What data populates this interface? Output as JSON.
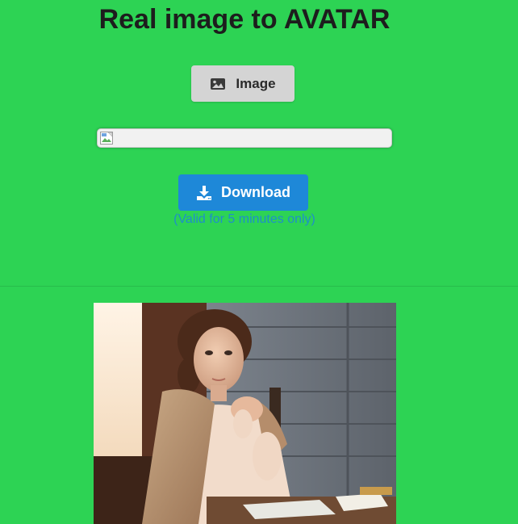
{
  "header": {
    "title": "Real image to AVATAR"
  },
  "upload": {
    "button_label": "Image",
    "icon": "image-icon"
  },
  "result_image": {
    "state": "broken",
    "icon": "broken-image-icon"
  },
  "download": {
    "button_label": "Download",
    "icon": "download-icon",
    "note": "(Valid for 5 minutes only)"
  },
  "colors": {
    "page_background": "#2dd354",
    "title_text": "#1d1d1d",
    "image_button_bg": "#d4d4d4",
    "download_button_bg": "#1e88d8",
    "note_text": "#1e8fc9"
  }
}
